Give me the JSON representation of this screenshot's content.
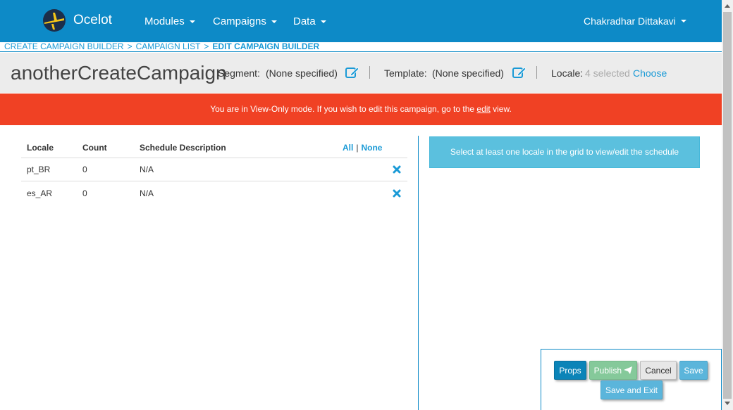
{
  "navbar": {
    "brand": "Ocelot",
    "menus": [
      {
        "label": "Modules"
      },
      {
        "label": "Campaigns"
      },
      {
        "label": "Data"
      }
    ],
    "user": "Chakradhar Dittakavi"
  },
  "breadcrumb": {
    "items": [
      "CREATE CAMPAIGN BUILDER",
      "CAMPAIGN LIST",
      "EDIT CAMPAIGN BUILDER"
    ],
    "separator": ">"
  },
  "header": {
    "title": "anotherCreateCampaign",
    "segment_label": "Segment:",
    "segment_value": "(None specified)",
    "template_label": "Template:",
    "template_value": "(None specified)",
    "locale_label": "Locale:",
    "locale_count": "4 selected",
    "locale_choose": "Choose"
  },
  "alert": {
    "text_before": "You are in View-Only mode. If you wish to edit this campaign, go to the",
    "link": "edit",
    "text_after": "view.",
    "color": "#f04124"
  },
  "grid": {
    "headers": {
      "locale": "Locale",
      "count": "Count",
      "description": "Schedule Description"
    },
    "select_all": "All",
    "select_sep": "|",
    "select_none": "None",
    "rows": [
      {
        "locale": "pt_BR",
        "count": "0",
        "description": "N/A"
      },
      {
        "locale": "es_AR",
        "count": "0",
        "description": "N/A"
      }
    ]
  },
  "info": {
    "message": "Select at least one locale in the grid to view/edit the schedule"
  },
  "actions": {
    "props": "Props",
    "publish": "Publish",
    "cancel": "Cancel",
    "save": "Save",
    "save_exit": "Save and Exit"
  },
  "colors": {
    "primary": "#0d8ac7",
    "link": "#1a9ad6",
    "info": "#5bc0de",
    "publish": "#85c99a"
  }
}
